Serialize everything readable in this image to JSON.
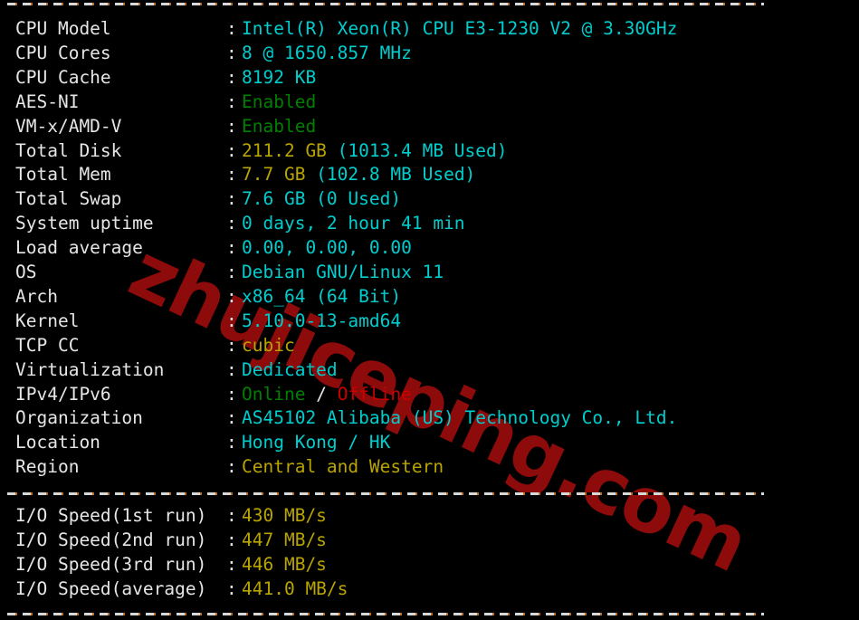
{
  "terminal": {
    "background": "#000000",
    "default_text_color": "#e6e6e6",
    "cyan": "#00cdcd",
    "yellow": "#b9a400",
    "green": "#008000",
    "red": "#cd0000",
    "separator_colors": [
      "#d8d8d8",
      "#c07020"
    ]
  },
  "watermark": {
    "text": "zhujiceping.com",
    "color": "#8d0b0b"
  },
  "separator": {
    "glyph": "-------------------------------------------------------------"
  },
  "system_info": [
    {
      "label": "CPU Model",
      "colon": ":",
      "parts": [
        {
          "text": "Intel(R) Xeon(R) CPU E3-1230 V2 @ 3.30GHz",
          "color": "cyan"
        }
      ]
    },
    {
      "label": "CPU Cores",
      "colon": ":",
      "parts": [
        {
          "text": "8 @ 1650.857 MHz",
          "color": "cyan"
        }
      ]
    },
    {
      "label": "CPU Cache",
      "colon": ":",
      "parts": [
        {
          "text": "8192 KB",
          "color": "cyan"
        }
      ]
    },
    {
      "label": "AES-NI",
      "colon": ":",
      "parts": [
        {
          "text": "Enabled",
          "color": "green"
        }
      ]
    },
    {
      "label": "VM-x/AMD-V",
      "colon": ":",
      "parts": [
        {
          "text": "Enabled",
          "color": "green"
        }
      ]
    },
    {
      "label": "Total Disk",
      "colon": ":",
      "parts": [
        {
          "text": "211.2 GB",
          "color": "yellow"
        },
        {
          "text": " (1013.4 MB Used)",
          "color": "cyan"
        }
      ]
    },
    {
      "label": "Total Mem",
      "colon": ":",
      "parts": [
        {
          "text": "7.7 GB",
          "color": "yellow"
        },
        {
          "text": " (102.8 MB Used)",
          "color": "cyan"
        }
      ]
    },
    {
      "label": "Total Swap",
      "colon": ":",
      "parts": [
        {
          "text": "7.6 GB (0 Used)",
          "color": "cyan"
        }
      ]
    },
    {
      "label": "System uptime",
      "colon": ":",
      "parts": [
        {
          "text": "0 days, 2 hour 41 min",
          "color": "cyan"
        }
      ]
    },
    {
      "label": "Load average",
      "colon": ":",
      "parts": [
        {
          "text": "0.00, 0.00, 0.00",
          "color": "cyan"
        }
      ]
    },
    {
      "label": "OS",
      "colon": ":",
      "parts": [
        {
          "text": "Debian GNU/Linux 11",
          "color": "cyan"
        }
      ]
    },
    {
      "label": "Arch",
      "colon": ":",
      "parts": [
        {
          "text": "x86_64 (64 Bit)",
          "color": "cyan"
        }
      ]
    },
    {
      "label": "Kernel",
      "colon": ":",
      "parts": [
        {
          "text": "5.10.0-13-amd64",
          "color": "cyan"
        }
      ]
    },
    {
      "label": "TCP CC",
      "colon": ":",
      "parts": [
        {
          "text": "cubic",
          "color": "yellow"
        }
      ]
    },
    {
      "label": "Virtualization",
      "colon": ":",
      "parts": [
        {
          "text": "Dedicated",
          "color": "cyan"
        }
      ]
    },
    {
      "label": "IPv4/IPv6",
      "colon": ":",
      "parts": [
        {
          "text": "Online",
          "color": "green"
        },
        {
          "text": " / ",
          "color": "white"
        },
        {
          "text": "Offline",
          "color": "red"
        }
      ]
    },
    {
      "label": "Organization",
      "colon": ":",
      "parts": [
        {
          "text": "AS45102 Alibaba (US) Technology Co., Ltd.",
          "color": "cyan"
        }
      ]
    },
    {
      "label": "Location",
      "colon": ":",
      "parts": [
        {
          "text": "Hong Kong / HK",
          "color": "cyan"
        }
      ]
    },
    {
      "label": "Region",
      "colon": ":",
      "parts": [
        {
          "text": "Central and Western",
          "color": "yellow"
        }
      ]
    }
  ],
  "io_speed": [
    {
      "label": "I/O Speed(1st run)",
      "colon": ":",
      "parts": [
        {
          "text": "430 MB/s",
          "color": "yellow"
        }
      ]
    },
    {
      "label": "I/O Speed(2nd run)",
      "colon": ":",
      "parts": [
        {
          "text": "447 MB/s",
          "color": "yellow"
        }
      ]
    },
    {
      "label": "I/O Speed(3rd run)",
      "colon": ":",
      "parts": [
        {
          "text": "446 MB/s",
          "color": "yellow"
        }
      ]
    },
    {
      "label": "I/O Speed(average)",
      "colon": ":",
      "parts": [
        {
          "text": "441.0 MB/s",
          "color": "yellow"
        }
      ]
    }
  ]
}
